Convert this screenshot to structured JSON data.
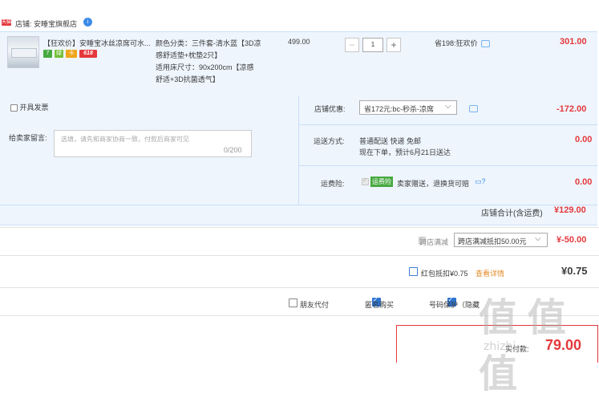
{
  "store": {
    "badge": "天猫",
    "label": "店铺: 安睡宝旗舰店",
    "icon": "info-icon"
  },
  "item": {
    "title": "【狂欢价】安睡宝冰丝凉席可水...",
    "tags": [
      "7",
      "绿",
      "卡",
      "618"
    ],
    "sku_lines": [
      "颜色分类：三件套-清水蓝【3D凉",
      "感舒适垫+枕垫2只】",
      "适用床尺寸：90x200cm【凉感",
      "舒适+3D抗菌透气】"
    ],
    "unit_price": "499.00",
    "quantity": "1",
    "qty_minus": "−",
    "qty_plus": "+",
    "discount_note": "省198:狂欢价",
    "total": "301.00"
  },
  "options": {
    "invoice_label": "开具发票",
    "note_label": "给卖家留言:",
    "note_placeholder": "选填，请先和商家协商一致，付款后商家可见",
    "note_count": "0/200",
    "shop_discount_label": "店铺优惠:",
    "shop_discount_select": "省172元:bc-秒杀-凉席",
    "shop_discount_value": "-172.00",
    "shipping_label": "运送方式:",
    "shipping_line1": "普通配送 快递 免邮",
    "shipping_line2": "现在下单，预计6月21日送达",
    "shipping_value": "0.00",
    "insurance_label": "运费险:",
    "insurance_badge": "运费险",
    "insurance_text": "卖家赠送，退换货可赔",
    "insurance_value": "0.00",
    "store_total_label": "店铺合计(含运费)",
    "store_total_value": "¥129.00"
  },
  "summary": {
    "cross_label": "跨店满减",
    "cross_select": "跨店满减抵扣50.00元",
    "cross_value": "¥-50.00",
    "redpacket_label": "红包抵扣¥0.75",
    "redpacket_link": "查看详情",
    "redpacket_value": "¥0.75",
    "friend_pay": "朋友代付",
    "anonymous": "匿名购买",
    "number_protect": "号码保护（隐藏",
    "pay_label": "实付款:",
    "pay_value": "79.00"
  },
  "watermark": {
    "text": "值 值 值",
    "url": "zhizhi..."
  },
  "colors": {
    "accent_red": "#e4393c",
    "row_bg": "#eef5fd",
    "link_blue": "#3c7fd6"
  }
}
